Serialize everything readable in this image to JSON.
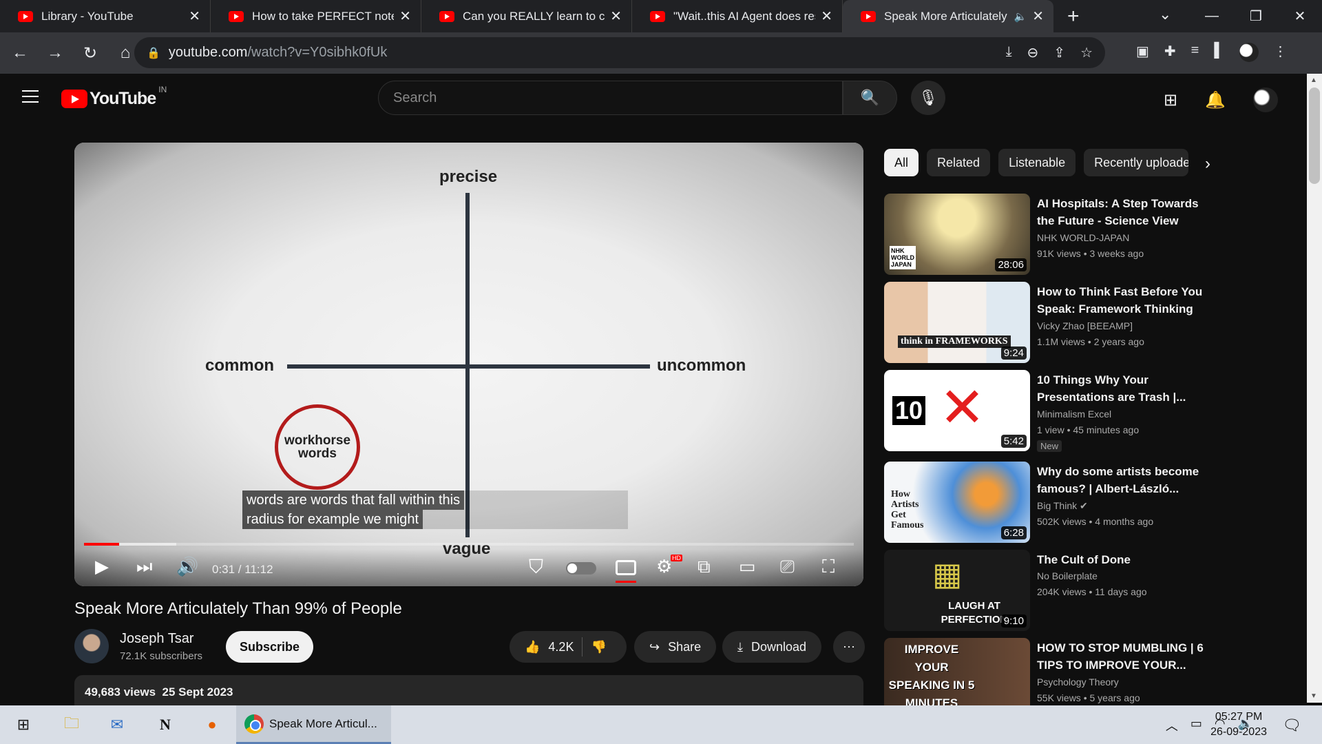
{
  "browser": {
    "tabs": [
      {
        "title": "Library - YouTube"
      },
      {
        "title": "How to take PERFECT notes w"
      },
      {
        "title": "Can you REALLY learn to code"
      },
      {
        "title": "\"Wait..this AI Agent does rese"
      },
      {
        "title": "Speak More Articulately T"
      }
    ],
    "url_host": "youtube.com",
    "url_path": "/watch?v=Y0sibhk0fUk"
  },
  "youtube": {
    "logo_text": "YouTube",
    "country_code": "IN",
    "search_placeholder": "Search"
  },
  "player": {
    "labels": {
      "top": "precise",
      "bottom": "vague",
      "left": "common",
      "right": "uncommon"
    },
    "circle_text": "workhorse words",
    "captions": [
      "words are words that fall within this",
      "radius for example we might"
    ],
    "time": "0:31 / 11:12",
    "progress_played": 0.046,
    "progress_buffered": 0.12,
    "settings_badge": "HD"
  },
  "video": {
    "title": "Speak More Articulately Than 99% of People",
    "channel": "Joseph Tsar",
    "subscribers": "72.1K subscribers",
    "subscribe_label": "Subscribe",
    "likes": "4.2K",
    "share_label": "Share",
    "download_label": "Download",
    "views": "49,683 views",
    "date": "25 Sept 2023"
  },
  "chips": [
    "All",
    "Related",
    "Listenable",
    "Recently uploade"
  ],
  "recommendations": [
    {
      "title": "AI Hospitals: A Step Towards the Future - Science View",
      "channel": "NHK WORLD-JAPAN",
      "views": "91K views",
      "age": "3 weeks ago",
      "duration": "28:06",
      "thumb_text": "NHK WORLD JAPAN"
    },
    {
      "title": "How to Think Fast Before You Speak: Framework Thinking",
      "channel": "Vicky Zhao [BEEAMP]",
      "views": "1.1M views",
      "age": "2 years ago",
      "duration": "9:24",
      "thumb_text": "think in FRAMEWORKS"
    },
    {
      "title": "10 Things Why Your Presentations are Trash |...",
      "channel": "Minimalism Excel",
      "views": "1 view",
      "age": "45 minutes ago",
      "duration": "5:42",
      "badge": "New",
      "thumb_text": "10"
    },
    {
      "title": "Why do some artists become famous? | Albert-László...",
      "channel": "Big Think",
      "views": "502K views",
      "age": "4 months ago",
      "duration": "6:28",
      "thumb_text": "How Artists Get Famous"
    },
    {
      "title": "The Cult of Done",
      "channel": "No Boilerplate",
      "views": "204K views",
      "age": "11 days ago",
      "duration": "9:10",
      "thumb_text": "LAUGH AT PERFECTION"
    },
    {
      "title": "HOW TO STOP MUMBLING | 6 TIPS TO IMPROVE YOUR...",
      "channel": "Psychology Theory",
      "views": "55K views",
      "age": "5 years ago",
      "duration": "",
      "thumb_text": "IMPROVE YOUR SPEAKING IN 5 MINUTES"
    }
  ],
  "taskbar": {
    "active_label": "Speak More Articul...",
    "time": "05:27 PM",
    "date": "26-09-2023"
  }
}
